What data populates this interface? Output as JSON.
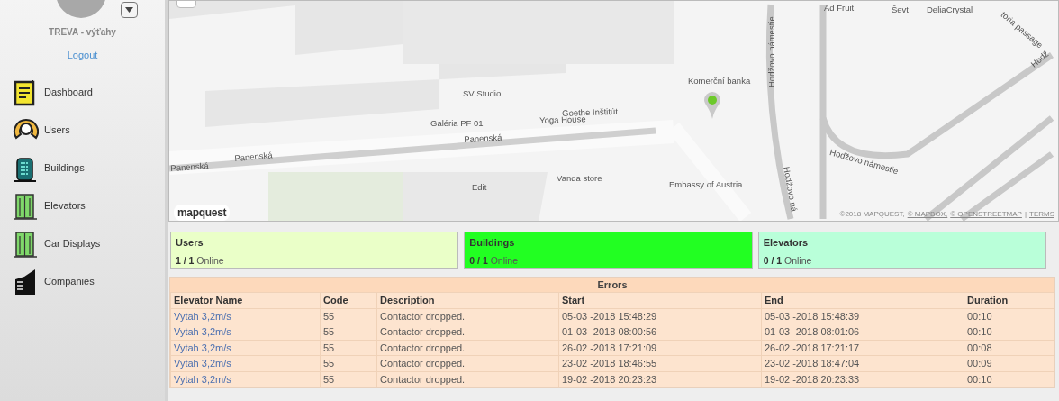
{
  "sidebar": {
    "company": "TREVA - výťahy",
    "logout": "Logout",
    "items": [
      {
        "label": "Dashboard",
        "kind": "dashboard"
      },
      {
        "label": "Users",
        "kind": "users"
      },
      {
        "label": "Buildings",
        "kind": "buildings"
      },
      {
        "label": "Elevators",
        "kind": "elevators"
      },
      {
        "label": "Car Displays",
        "kind": "elevators"
      },
      {
        "label": "Companies",
        "kind": "companies"
      }
    ]
  },
  "map": {
    "logo": "mapquest",
    "attribution": [
      "©2018 MAPQUEST,",
      "© MAPBOX,",
      "© OPENSTREETMAP",
      "|",
      "TERMS"
    ],
    "labels": [
      "Ad Fruit",
      "Ševt",
      "DeliaCrystal",
      "toria passage",
      "Hodžovo námestie",
      "Hodž",
      "Komerční banka",
      "SV Studio",
      "Goethe Inštitút",
      "Yoga House",
      "Galéria PF 01",
      "Panenská",
      "Hodžovo námestie",
      "Panenská",
      "Panenská",
      "Edit",
      "Vanda store",
      "Embassy of Austria",
      "Hodžovo ná"
    ]
  },
  "cards": [
    {
      "title": "Users",
      "count": "1 / 1",
      "status": "Online",
      "color": "#eaffc8"
    },
    {
      "title": "Buildings",
      "count": "0 / 1",
      "status": "Online",
      "color": "#22ff22"
    },
    {
      "title": "Elevators",
      "count": "0 / 1",
      "status": "Online",
      "color": "#b9ffd9"
    }
  ],
  "errors": {
    "title": "Errors",
    "columns": [
      "Elevator Name",
      "Code",
      "Description",
      "Start",
      "End",
      "Duration"
    ],
    "rows": [
      [
        "Vytah 3,2m/s",
        "55",
        "Contactor dropped.",
        "05-03 -2018 15:48:29",
        "05-03 -2018 15:48:39",
        "00:10"
      ],
      [
        "Vytah 3,2m/s",
        "55",
        "Contactor dropped.",
        "01-03 -2018 08:00:56",
        "01-03 -2018 08:01:06",
        "00:10"
      ],
      [
        "Vytah 3,2m/s",
        "55",
        "Contactor dropped.",
        "26-02 -2018 17:21:09",
        "26-02 -2018 17:21:17",
        "00:08"
      ],
      [
        "Vytah 3,2m/s",
        "55",
        "Contactor dropped.",
        "23-02 -2018 18:46:55",
        "23-02 -2018 18:47:04",
        "00:09"
      ],
      [
        "Vytah 3,2m/s",
        "55",
        "Contactor dropped.",
        "19-02 -2018 20:23:23",
        "19-02 -2018 20:23:33",
        "00:10"
      ]
    ]
  }
}
